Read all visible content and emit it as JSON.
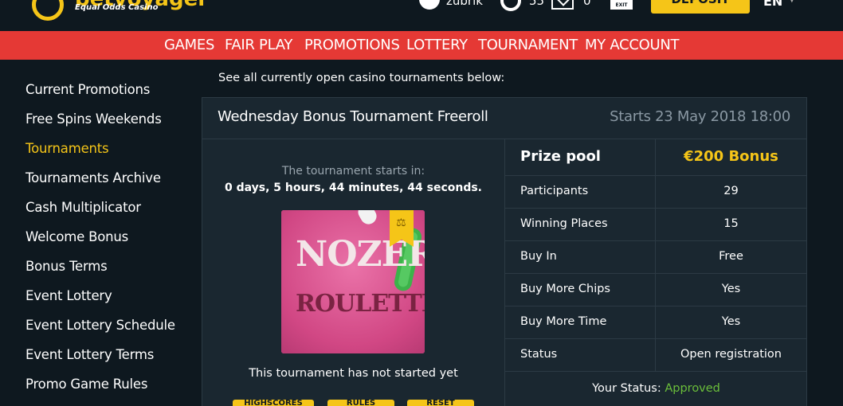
{
  "header": {
    "logo_text": "betvoyager",
    "logo_tagline": "Equal Odds Casino",
    "username": "zubrik",
    "coins": "55",
    "messages": "0",
    "exit_label": "EXIT",
    "deposit_label": "DEPOSIT",
    "language": "EN"
  },
  "nav": [
    "GAMES",
    "FAIR PLAY",
    "PROMOTIONS",
    "LOTTERY",
    "TOURNAMENT",
    "MY ACCOUNT"
  ],
  "sidebar": {
    "items": [
      "Current Promotions",
      "Free Spins Weekends",
      "Tournaments",
      "Tournaments Archive",
      "Cash Multiplicator",
      "Welcome Bonus",
      "Bonus Terms",
      "Event Lottery",
      "Event Lottery Schedule",
      "Event Lottery Terms",
      "Promo Game Rules"
    ],
    "active": "Tournaments"
  },
  "main": {
    "intro": "See all currently open casino tournaments below:",
    "tournament": {
      "title": "Wednesday Bonus Tournament Freeroll",
      "starts": "Starts 23 May 2018 18:00",
      "countdown_label": "The tournament starts in:",
      "countdown": "0 days, 5 hours, 44 minutes, 44 seconds.",
      "game_title_line1": "NOZERO",
      "game_title_line2": "ROULETTE",
      "not_started": "This tournament has not started yet",
      "buttons": [
        "HIGHSCORES",
        "RULES",
        "RESET"
      ],
      "prize_label": "Prize pool",
      "prize_value": "€200 Bonus",
      "details": [
        {
          "label": "Participants",
          "value": "29"
        },
        {
          "label": "Winning Places",
          "value": "15"
        },
        {
          "label": "Buy In",
          "value": "Free"
        },
        {
          "label": "Buy More Chips",
          "value": "Yes"
        },
        {
          "label": "Buy More Time",
          "value": "Yes"
        },
        {
          "label": "Status",
          "value": "Open registration"
        }
      ],
      "your_status_label": "Your Status:",
      "your_status_value": "Approved"
    }
  },
  "colors": {
    "background": "#0e181f",
    "nav_red": "#e53935",
    "accent_yellow": "#f5c518",
    "status_green": "#6bbf3a"
  }
}
